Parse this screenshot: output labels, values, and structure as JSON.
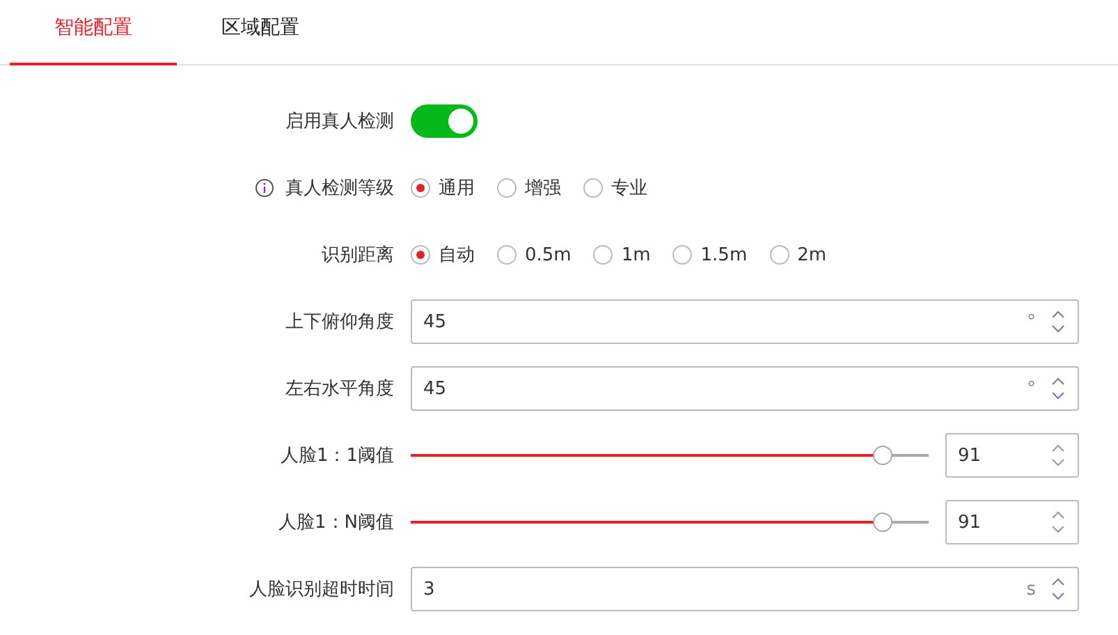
{
  "tabs": [
    {
      "label": "智能配置",
      "selected": true
    },
    {
      "label": "区域配置",
      "selected": false
    }
  ],
  "rows": [
    {
      "kind": "toggle",
      "label": "启用真人检测",
      "on": true
    },
    {
      "kind": "radio",
      "label": "真人检测等级",
      "info": true,
      "options": [
        {
          "label": "通用",
          "selected": true
        },
        {
          "label": "增强",
          "selected": false
        },
        {
          "label": "专业",
          "selected": false
        }
      ]
    },
    {
      "kind": "radio",
      "label": "识别距离",
      "options": [
        {
          "label": "自动",
          "selected": true
        },
        {
          "label": "0.5m",
          "selected": false
        },
        {
          "label": "1m",
          "selected": false
        },
        {
          "label": "1.5m",
          "selected": false
        },
        {
          "label": "2m",
          "selected": false
        }
      ]
    },
    {
      "kind": "number",
      "label": "上下俯仰角度",
      "value": "45",
      "unit": "°"
    },
    {
      "kind": "number",
      "label": "左右水平角度",
      "value": "45",
      "unit": "°"
    },
    {
      "kind": "slider",
      "label": "人脸1：1阈值",
      "level": 0.91,
      "value": "91"
    },
    {
      "kind": "slider",
      "label": "人脸1：N阈值",
      "level": 0.91,
      "value": "91"
    },
    {
      "kind": "number",
      "label": "人脸识别超时时间",
      "value": "3",
      "unit": "s"
    }
  ]
}
